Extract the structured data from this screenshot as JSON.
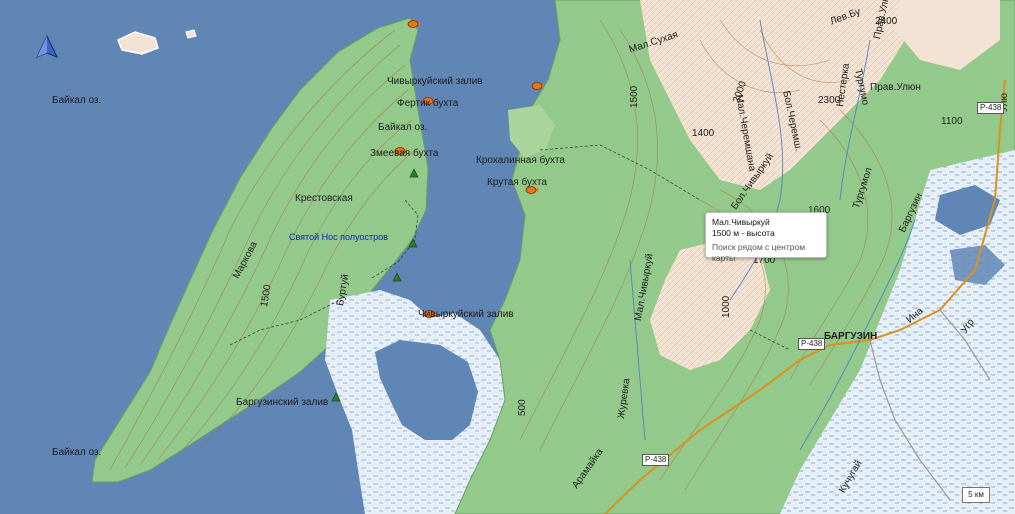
{
  "colors": {
    "water": "#5f86b5",
    "forest": "#93c98a",
    "mountain": "#f2e3d4",
    "wetland": "#e6eef6",
    "contour": "#a8703d",
    "road": "#d9921e",
    "fish_marker": "#e8731a"
  },
  "labels": {
    "baikal_nw": "Байкал оз.",
    "baikal_sw": "Байкал оз.",
    "baikal_mid": "Байкал оз.",
    "chivyrkuy_bay_n": "Чивыркуйский залив",
    "chivyrkuy_bay_s": "Чивыркуйский залив",
    "fertik": "Фертик бухта",
    "zmeevaya": "Змеевая бухта",
    "krokhalinnaya": "Крохалинная бухта",
    "krutaya": "Крутая бухта",
    "krestovskaya": "Крестовская",
    "svyatoy_nos": "Святой Нос полуостров",
    "markova": "Маркова",
    "burtuy": "Буртуй",
    "barguzin_bay": "Баргузинский залив",
    "mal_sukhaya": "Мал.Сухая",
    "mal_chivyrkuy": "Мал.Чивыркуй",
    "bol_chivyrkuy": "Бол.Чивыркуй",
    "zhurevka": "Журевка",
    "aramaika": "Арамайка",
    "turgumol": "Тургумол",
    "barguzin_river": "Баргузин",
    "barguzin_town": "БАРГУЗИН",
    "kuchugai": "Кучугай",
    "ina": "Ина",
    "ulyun": "Прав.Улюн",
    "ulyun2": "Улюн",
    "lev_bu": "Лев.Бу",
    "mal_cheremsh": "Мал.Черемшана",
    "bol_cheremsh": "Бол.Черемш.",
    "nesterka": "Нестерка",
    "turgumo": "Тургумо",
    "prav_ulyun": "Прав.Улюн",
    "ulyu": "Улю",
    "ugr": "Угр",
    "h1500a": "1500",
    "h1500b": "1500",
    "h500": "500",
    "h1000": "1000",
    "h1400": "1400",
    "h2000": "2000",
    "h2300": "2300",
    "h2400": "2400",
    "h1100": "1100",
    "h1600": "1600",
    "h1700": "1700"
  },
  "roads": {
    "p438_a": "P-438",
    "p438_b": "P-438",
    "p438_c": "P-438"
  },
  "tooltip": {
    "title": "Мал.Чивыркуй",
    "subtitle": "1500 м - высота",
    "action": "Поиск рядом с центром карты"
  },
  "scale_label": "5 км"
}
